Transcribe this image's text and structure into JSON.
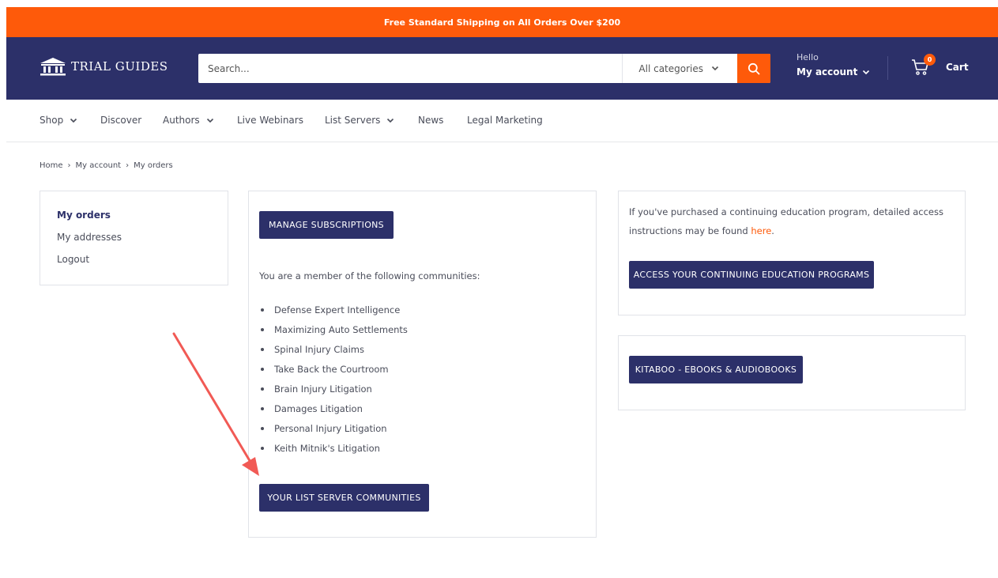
{
  "announcement": "Free Standard Shipping on All Orders Over $200",
  "brand": {
    "logo_name": "bank-building-logo",
    "name": "TRIAL GUIDES"
  },
  "search": {
    "placeholder": "Search...",
    "category": "All categories",
    "icon": "search-icon"
  },
  "account": {
    "greeting": "Hello",
    "label": "My account"
  },
  "cart": {
    "count": "0",
    "label": "Cart"
  },
  "nav": {
    "items": [
      {
        "label": "Shop",
        "dropdown": true
      },
      {
        "label": "Discover",
        "dropdown": false
      },
      {
        "label": "Authors",
        "dropdown": true
      },
      {
        "label": "Live Webinars",
        "dropdown": false
      },
      {
        "label": "List Servers",
        "dropdown": true
      },
      {
        "label": "News",
        "dropdown": false
      },
      {
        "label": "Legal Marketing",
        "dropdown": false
      }
    ]
  },
  "breadcrumb": [
    "Home",
    "My account",
    "My orders"
  ],
  "sidebar": {
    "items": [
      {
        "label": "My orders",
        "active": true
      },
      {
        "label": "My addresses",
        "active": false
      },
      {
        "label": "Logout",
        "active": false
      }
    ]
  },
  "main": {
    "manage_button": "MANAGE SUBSCRIPTIONS",
    "member_text": "You are a member of the following communities:",
    "communities": [
      "Defense Expert Intelligence",
      "Maximizing Auto Settlements",
      "Spinal Injury Claims",
      "Take Back the Courtroom",
      "Brain Injury Litigation",
      "Damages Litigation",
      "Personal Injury Litigation",
      "Keith Mitnik's Litigation"
    ],
    "list_server_button": "YOUR LIST SERVER COMMUNITIES"
  },
  "continuing_ed": {
    "text": "If you've purchased a continuing education program, detailed access instructions may be found",
    "link": "here",
    "suffix": ".",
    "button": "ACCESS YOUR CONTINUING EDUCATION PROGRAMS"
  },
  "kitaboo": {
    "button": "KITABOO - EBOOKS & AUDIOBOOKS"
  },
  "colors": {
    "accent": "#fe5a0a",
    "navy": "#2c3069",
    "annotation_arrow": "#f15a55"
  }
}
